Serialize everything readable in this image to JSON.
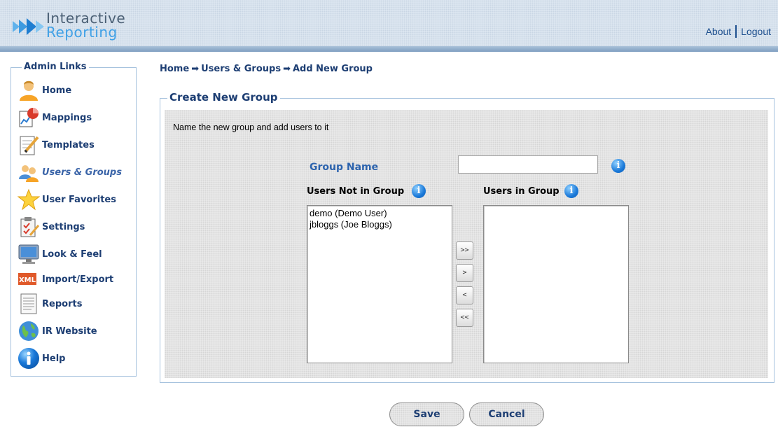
{
  "app": {
    "logo_line1": "Interactive",
    "logo_line2": "Reporting"
  },
  "header": {
    "links": {
      "about": "About",
      "logout": "Logout"
    }
  },
  "sidebar": {
    "title": "Admin Links",
    "items": [
      {
        "label": "Home",
        "icon": "user-icon",
        "active": false
      },
      {
        "label": "Mappings",
        "icon": "chart-icon",
        "active": false
      },
      {
        "label": "Templates",
        "icon": "notepad-pencil-icon",
        "active": false
      },
      {
        "label": "Users & Groups",
        "icon": "users-icon",
        "active": true
      },
      {
        "label": "User Favorites",
        "icon": "star-icon",
        "active": false
      },
      {
        "label": "Settings",
        "icon": "clipboard-check-icon",
        "active": false
      },
      {
        "label": "Look & Feel",
        "icon": "monitor-icon",
        "active": false
      },
      {
        "label": "Import/Export",
        "icon": "xml-icon",
        "active": false
      },
      {
        "label": "Reports",
        "icon": "document-icon",
        "active": false
      },
      {
        "label": "IR Website",
        "icon": "globe-icon",
        "active": false
      },
      {
        "label": "Help",
        "icon": "info-icon",
        "active": false
      }
    ]
  },
  "breadcrumb": {
    "items": [
      "Home",
      "Users & Groups",
      "Add New Group"
    ],
    "separator": "➡"
  },
  "form": {
    "title": "Create New Group",
    "instructions": "Name the new group and add users to it",
    "group_name_label": "Group Name",
    "group_name_value": "",
    "info_glyph": "i",
    "users_not_in_group_label": "Users Not in Group",
    "users_in_group_label": "Users in Group",
    "users_not_in_group": [
      "demo (Demo User)",
      "jbloggs (Joe Bloggs)"
    ],
    "users_in_group": [],
    "move_buttons": {
      "add_all": ">>",
      "add": ">",
      "remove": "<",
      "remove_all": "<<"
    }
  },
  "actions": {
    "save": "Save",
    "cancel": "Cancel"
  },
  "colors": {
    "brand_dark": "#1d3e73",
    "accent_blue": "#2c63ad",
    "border": "#a6c2de"
  }
}
